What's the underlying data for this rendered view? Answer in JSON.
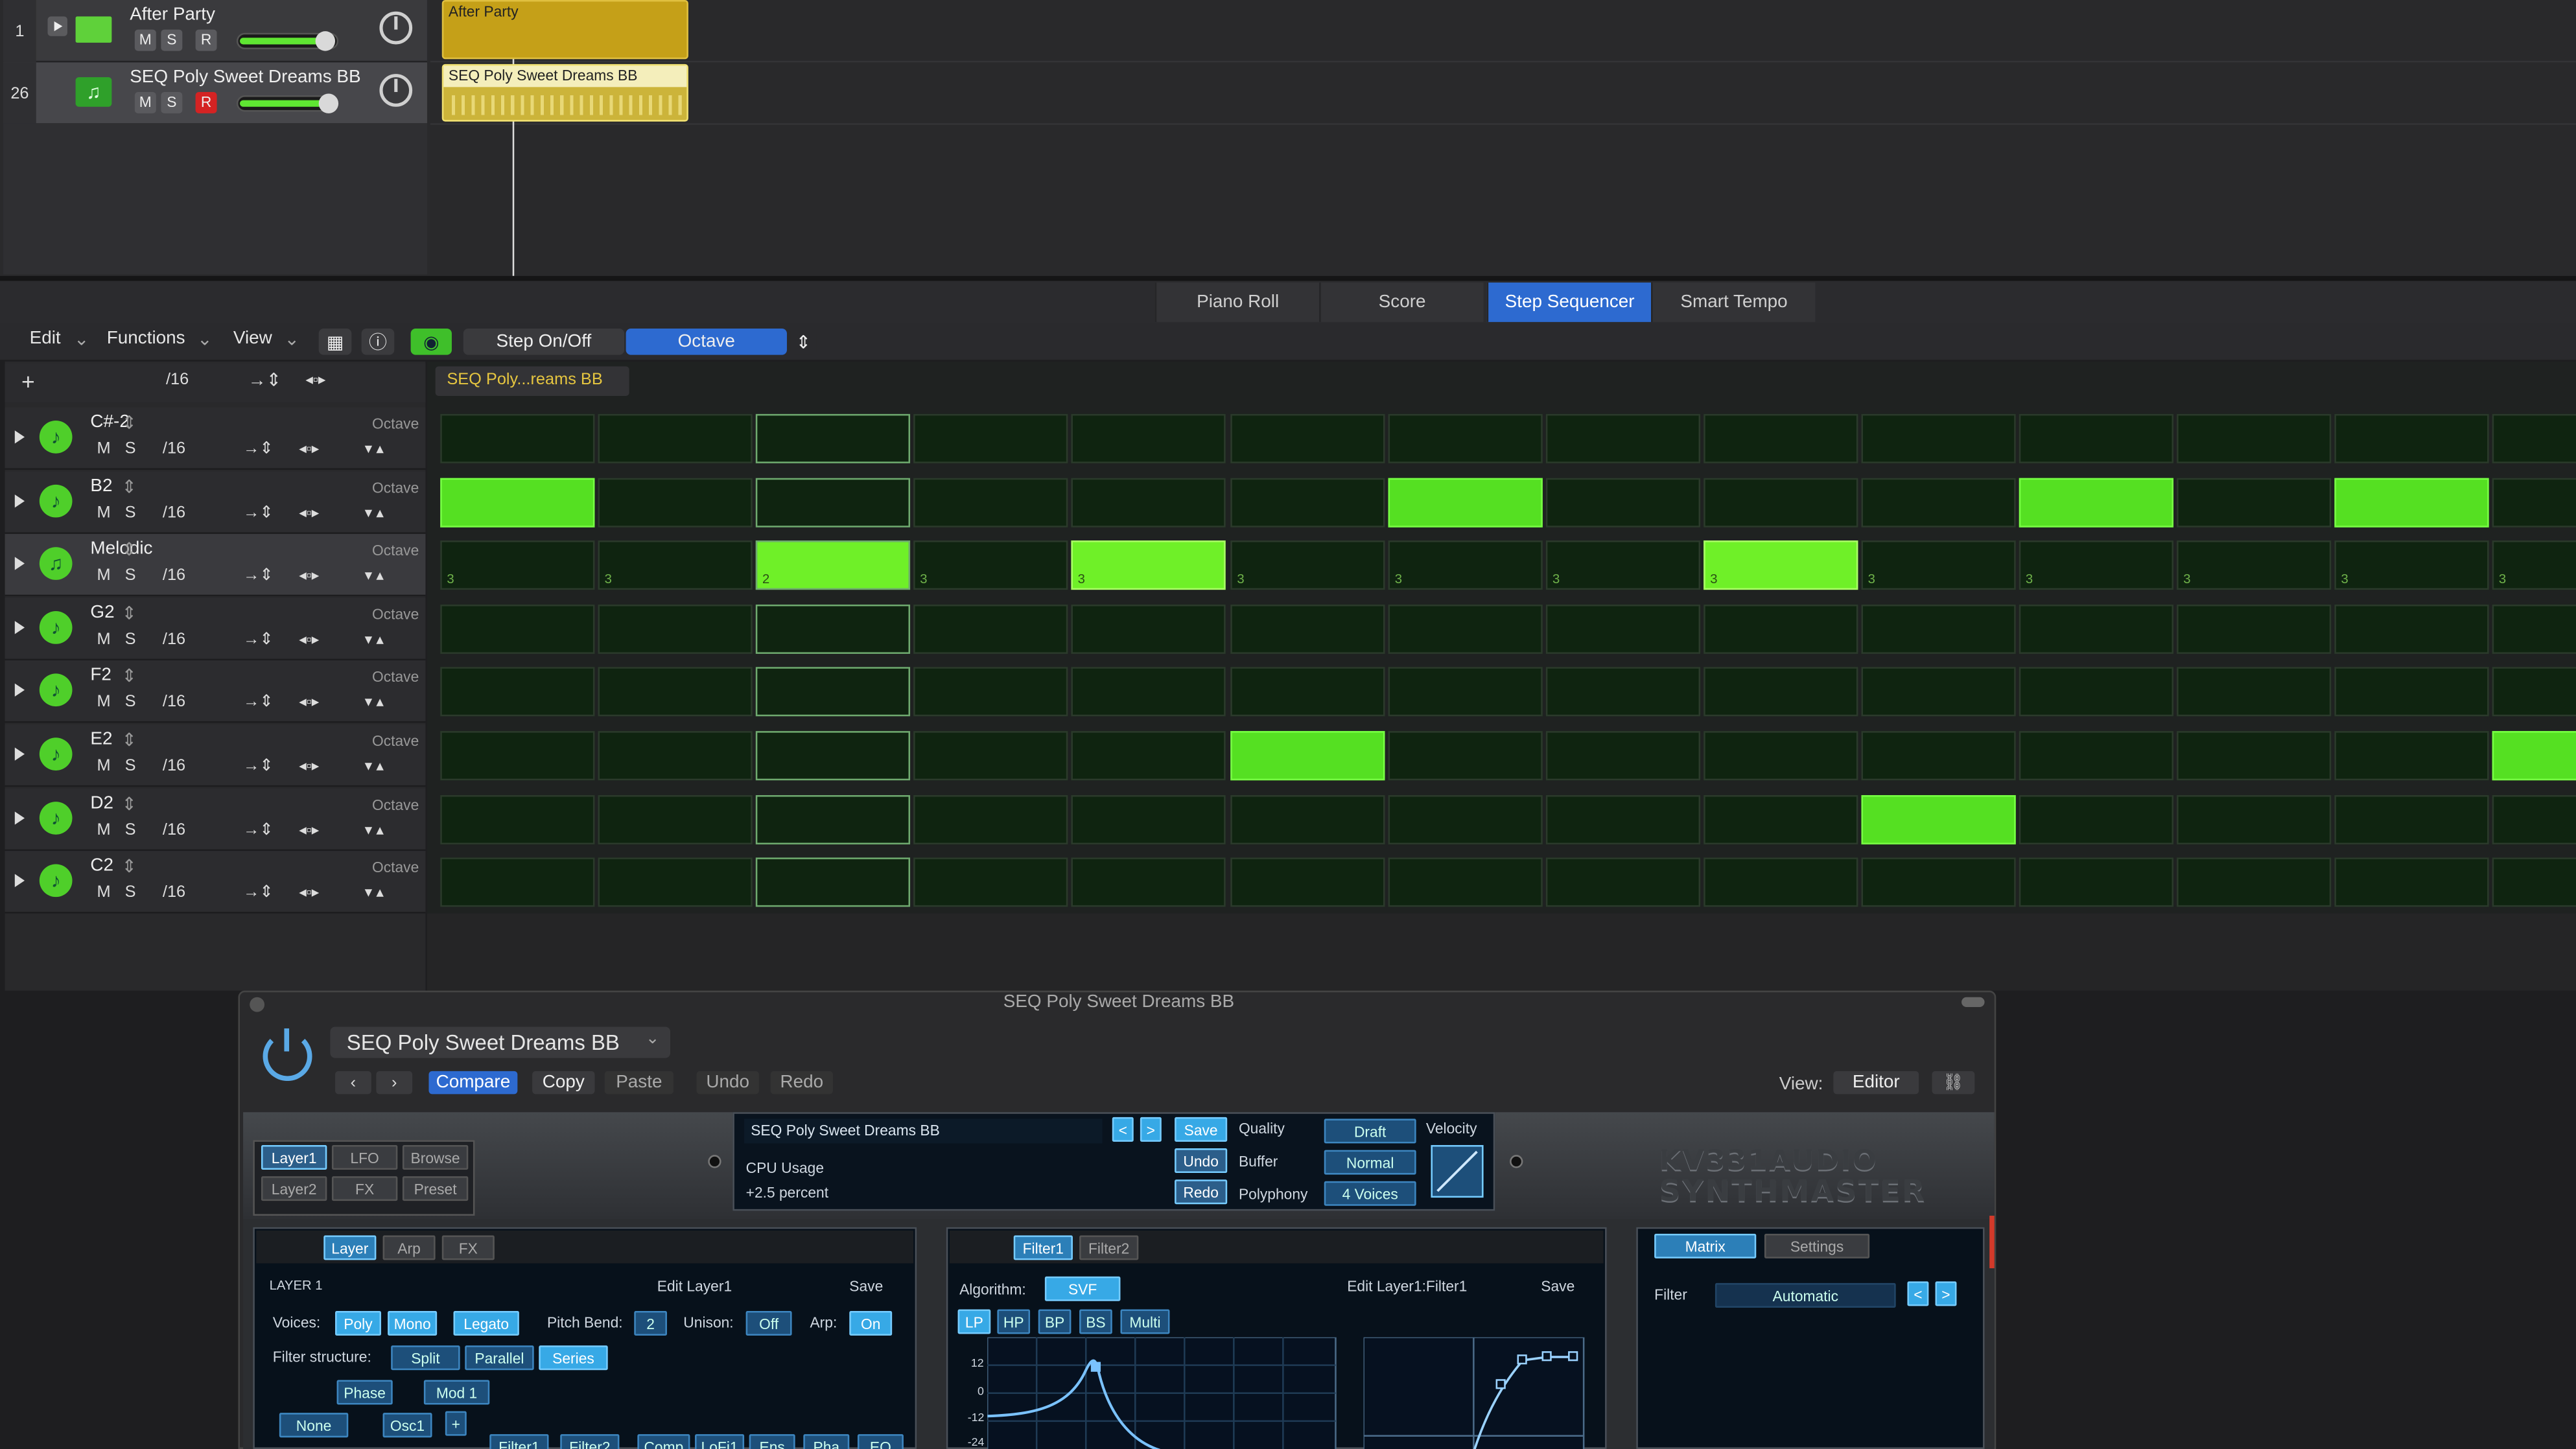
{
  "tracks": [
    {
      "number": "1",
      "name": "After Party",
      "region": "After Party"
    },
    {
      "number": "26",
      "name": "SEQ Poly Sweet Dreams BB",
      "region": "SEQ Poly Sweet Dreams BB"
    }
  ],
  "track_buttons": {
    "mute": "M",
    "solo": "S",
    "record": "R"
  },
  "editor_tabs": [
    "Piano Roll",
    "Score",
    "Step Sequencer",
    "Smart Tempo"
  ],
  "toolbar": {
    "edit": "Edit",
    "functions": "Functions",
    "view": "View",
    "step_on_off": "Step On/Off",
    "octave": "Octave"
  },
  "seq_header": {
    "add": "+",
    "rate": "/16",
    "region_label": "SEQ Poly...reams BB"
  },
  "rows": [
    {
      "name": "C#-2",
      "mode": "Octave",
      "rate": "/16"
    },
    {
      "name": "B2",
      "mode": "Octave",
      "rate": "/16"
    },
    {
      "name": "Melodic",
      "mode": "Octave",
      "rate": "/16"
    },
    {
      "name": "G2",
      "mode": "Octave",
      "rate": "/16"
    },
    {
      "name": "F2",
      "mode": "Octave",
      "rate": "/16"
    },
    {
      "name": "E2",
      "mode": "Octave",
      "rate": "/16"
    },
    {
      "name": "D2",
      "mode": "Octave",
      "rate": "/16"
    },
    {
      "name": "C2",
      "mode": "Octave",
      "rate": "/16"
    }
  ],
  "steps": {
    "active": [
      [],
      [
        0,
        6,
        10,
        12
      ],
      [
        2,
        4,
        8
      ],
      [],
      [],
      [
        5,
        13
      ],
      [
        9
      ],
      []
    ],
    "melodic_values": [
      "3",
      "3",
      "2",
      "3",
      "3",
      "3",
      "3",
      "3",
      "3",
      "3",
      "3",
      "3",
      "3",
      "3"
    ],
    "highlighted_column": 2
  },
  "plugin": {
    "window_title": "SEQ Poly Sweet Dreams BB",
    "preset": "SEQ Poly Sweet Dreams BB",
    "compare": "Compare",
    "copy": "Copy",
    "paste": "Paste",
    "undo": "Undo",
    "redo": "Redo",
    "view_label": "View:",
    "view_value": "Editor"
  },
  "synth": {
    "logo_line1": "KV331AUDIO",
    "logo_line2": "SYNTHMASTER",
    "nav": [
      "Layer1",
      "LFO",
      "Browse",
      "Layer2",
      "FX",
      "Preset"
    ],
    "preset_name": "SEQ Poly Sweet Dreams BB",
    "save": "Save",
    "cpu_label": "CPU Usage",
    "cpu_value": "+2.5 percent",
    "undo": "Undo",
    "redo": "Redo",
    "quality_label": "Quality",
    "quality_value": "Draft",
    "buffer_label": "Buffer",
    "buffer_value": "Normal",
    "polyphony_label": "Polyphony",
    "polyphony_value": "4 Voices",
    "velocity_label": "Velocity",
    "layer_tabs": [
      "Layer",
      "Arp",
      "FX"
    ],
    "layer_title": "LAYER 1",
    "edit_layer": "Edit Layer1",
    "voices_label": "Voices:",
    "voices": [
      "Poly",
      "Mono",
      "Legato"
    ],
    "pitch_bend_label": "Pitch Bend:",
    "pitch_bend": "2",
    "unison_label": "Unison:",
    "unison": "Off",
    "arp_label": "Arp:",
    "arp": "On",
    "filter_structure_label": "Filter structure:",
    "filter_structure": [
      "Split",
      "Parallel",
      "Series"
    ],
    "routing": [
      "Phase",
      "Mod 1",
      "None",
      "Osc1",
      "+",
      "Filter1",
      "Filter2",
      "Comp",
      "LoFi1",
      "Ens",
      "Pha",
      "EQ"
    ],
    "filter_tabs": [
      "Filter1",
      "Filter2"
    ],
    "algorithm_label": "Algorithm:",
    "algorithm": "SVF",
    "edit_filter": "Edit Layer1:Filter1",
    "filter_types": [
      "LP",
      "HP",
      "BP",
      "BS",
      "Multi"
    ],
    "graph_ticks": [
      "12",
      "0",
      "-12",
      "-24"
    ],
    "right_tabs": [
      "Matrix",
      "Settings"
    ],
    "matrix_label": "Filter",
    "matrix_value": "Automatic"
  }
}
